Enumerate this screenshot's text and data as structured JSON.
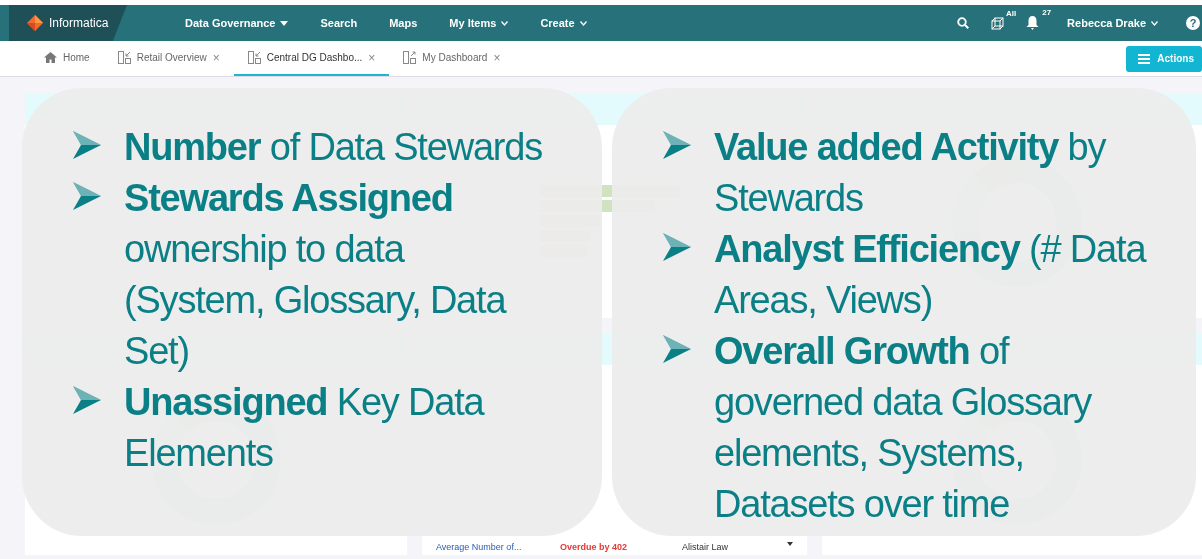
{
  "topbar": {
    "brand": "Informatica",
    "nav": [
      {
        "label": "Data Governance",
        "kind": "dropdown"
      },
      {
        "label": "Search",
        "kind": "link"
      },
      {
        "label": "Maps",
        "kind": "link"
      },
      {
        "label": "My Items",
        "kind": "menu"
      },
      {
        "label": "Create",
        "kind": "menu"
      }
    ],
    "catalog_badge": "All",
    "notification_count": "27",
    "user": "Rebecca Drake",
    "help": "?"
  },
  "tabs": [
    {
      "label": "Home",
      "kind": "home",
      "selected": false
    },
    {
      "label": "Retail Overview",
      "kind": "dashboard",
      "close": "×",
      "selected": false
    },
    {
      "label": "Central DG Dashbo...",
      "kind": "dashboard",
      "close": "×",
      "selected": true
    },
    {
      "label": "My Dashboard",
      "kind": "shared",
      "close": "×",
      "selected": false
    }
  ],
  "actions_button": "Actions",
  "overdue_row": {
    "object": "Average Number of...",
    "due": "Overdue by 402",
    "owner": "Alistair Law"
  },
  "overlay": {
    "left": [
      "**Number** of Data Stewards",
      "**Stewards Assigned** ownership to data (System, Glossary, Data Set)",
      "**Unassigned** Key Data Elements"
    ],
    "right": [
      "**Value added Activity** by Stewards",
      "**Analyst Efficiency** (# Data Areas, Views)",
      "**Overall Growth** of governed data Glossary elements, Systems, Datasets over time"
    ]
  }
}
